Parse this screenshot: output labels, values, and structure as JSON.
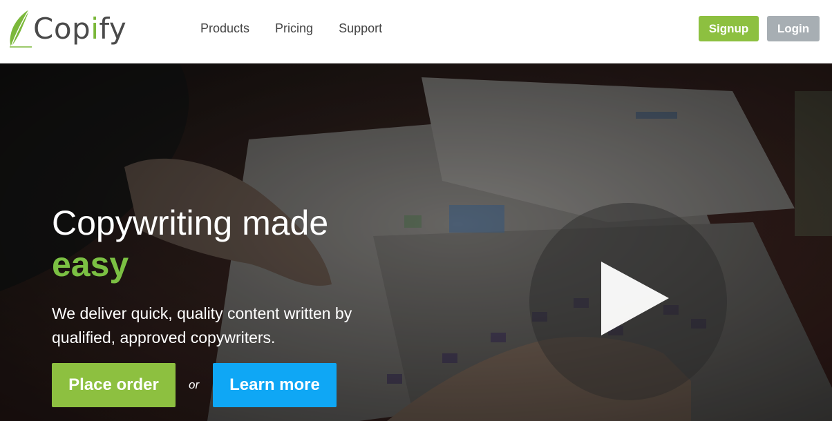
{
  "brand": {
    "name_pre": "Cop",
    "name_i": "i",
    "name_post": "fy",
    "accent": "#7bb83a"
  },
  "nav": {
    "items": [
      "Products",
      "Pricing",
      "Support"
    ]
  },
  "auth": {
    "signup": "Signup",
    "login": "Login"
  },
  "hero": {
    "headline": "Copywriting made",
    "headline_em": "easy",
    "subtext": "We deliver quick, quality content written by qualified, approved copywriters.",
    "cta_primary": "Place order",
    "or": "or",
    "cta_secondary": "Learn more"
  },
  "colors": {
    "green": "#8dc040",
    "blue": "#0fa7f5",
    "gray": "#a7aeb3"
  }
}
